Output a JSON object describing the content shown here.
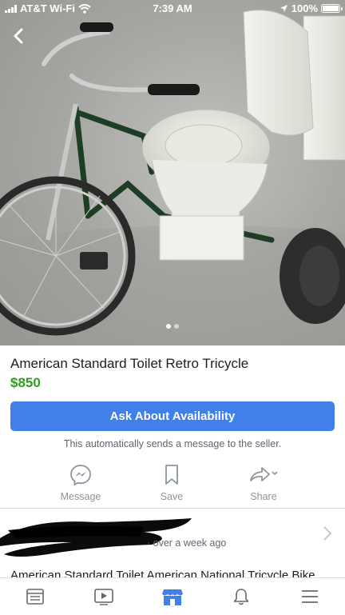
{
  "status_bar": {
    "carrier": "AT&T Wi-Fi",
    "time": "7:39 AM",
    "battery": "100%"
  },
  "gallery": {
    "dots": 2,
    "active_index": 0
  },
  "listing": {
    "title": "American Standard Toilet Retro Tricycle",
    "price": "$850",
    "ask_button_label": "Ask About Availability",
    "ask_note": "This automatically sends a message to the seller."
  },
  "actions": {
    "message_label": "Message",
    "save_label": "Save",
    "share_label": "Share"
  },
  "seller": {
    "posted": "over a week ago"
  },
  "more_listings": {
    "title": "American Standard Toilet American National Tricycle Bike"
  },
  "tabbar": {
    "tabs": [
      "news-feed",
      "watch",
      "marketplace",
      "notifications",
      "menu"
    ],
    "active": "marketplace"
  },
  "colors": {
    "accent": "#4080e8",
    "price": "#2f9e1f",
    "muted": "#8d949e"
  }
}
